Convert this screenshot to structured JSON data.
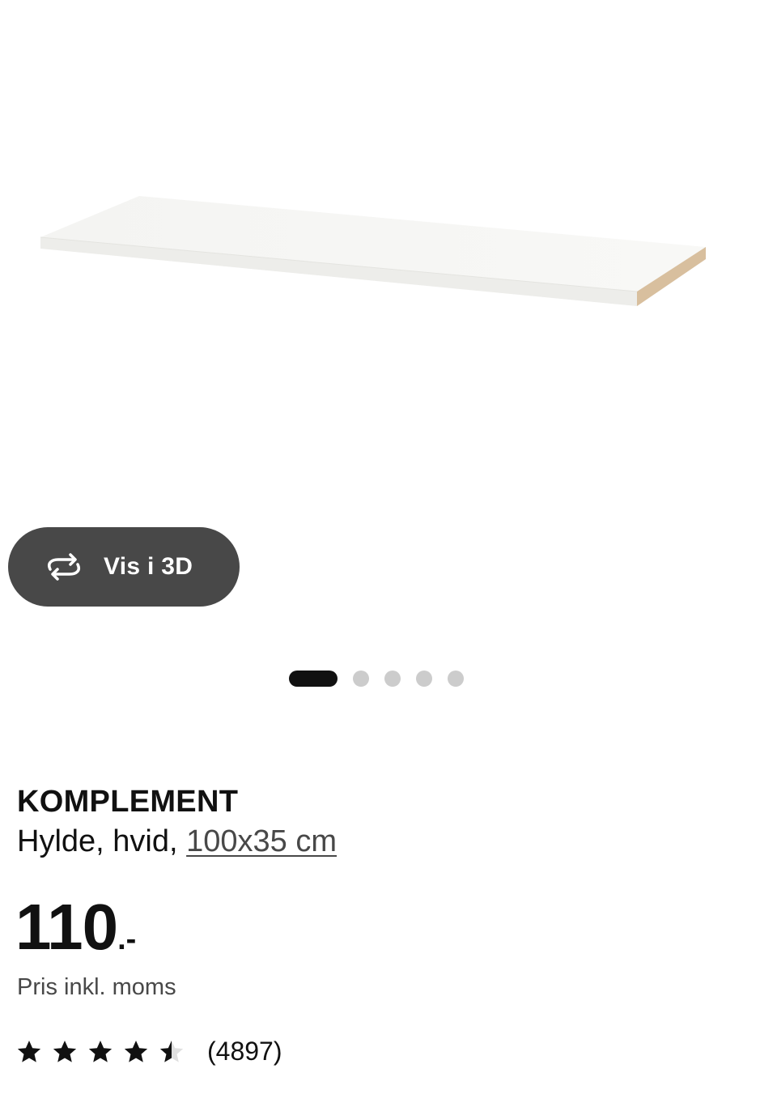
{
  "gallery": {
    "view_3d_label": "Vis i 3D",
    "dots_count": 5,
    "active_index": 0
  },
  "product": {
    "name": "KOMPLEMENT",
    "description": "Hylde, hvid,",
    "size": "100x35 cm",
    "price_integer": "110",
    "price_suffix": ".-",
    "price_note": "Pris inkl. moms",
    "rating_value": 4.5,
    "rating_max": 5,
    "review_count": "(4897)"
  },
  "colors": {
    "button_bg": "#484848",
    "dot_active": "#111111",
    "dot_inactive": "#cccccc",
    "text_primary": "#111111",
    "text_secondary": "#484848"
  }
}
